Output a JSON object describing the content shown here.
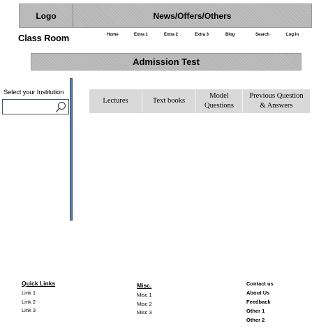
{
  "header": {
    "logo": "Logo",
    "news": "News/Offers/Others"
  },
  "brand": "Class Room",
  "nav": [
    "Home",
    "Extra 1",
    "Extra 2",
    "Extra 3",
    "Blog",
    "Search",
    "Log in"
  ],
  "admission": "Admission Test",
  "sidebar": {
    "label": "Select your Institution",
    "search_value": ""
  },
  "tabs": [
    {
      "label": "Lectures"
    },
    {
      "label": "Text books"
    },
    {
      "label": "Model Questions"
    },
    {
      "label": "Previous Question & Answers"
    }
  ],
  "footer": {
    "quick_links": {
      "heading": "Quick Links",
      "items": [
        "Link 1",
        "Link 2",
        "Link 3"
      ]
    },
    "misc": {
      "heading": "Misc.",
      "items": [
        "Misc 1",
        "Misc 2",
        "Misc 3"
      ]
    },
    "contact": {
      "items": [
        "Contact us",
        "About Us",
        "Feedback",
        "Other 1",
        "Other 2"
      ]
    }
  }
}
